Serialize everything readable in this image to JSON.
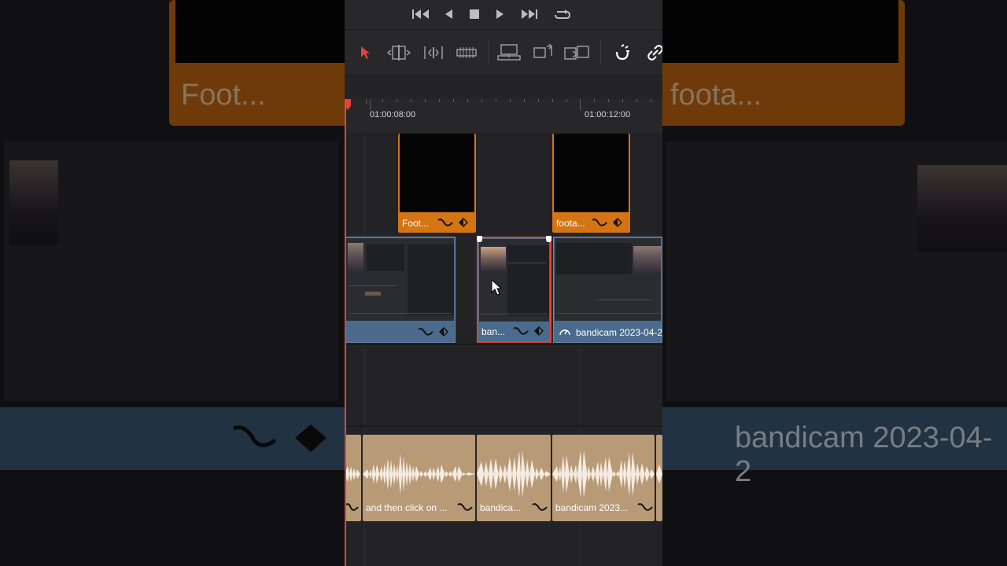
{
  "timeline": {
    "ruler": {
      "tc_left": "01:00:08:00",
      "tc_right": "01:00:12:00"
    },
    "video_track_2": [
      {
        "label": "Foot..."
      },
      {
        "label": "foota..."
      }
    ],
    "video_track_1": [
      {
        "label": ""
      },
      {
        "label": "ban..."
      },
      {
        "label": "bandicam 2023-04-2"
      }
    ],
    "audio_track": [
      {
        "label": ""
      },
      {
        "label": "and then click on ..."
      },
      {
        "label": "bandica..."
      },
      {
        "label": "bandicam 2023..."
      }
    ]
  },
  "background": {
    "left_clip_label": "Foot...",
    "right_clip_label": "foota...",
    "right_strip_label": "bandicam 2023-04-2"
  },
  "colors": {
    "accent_playhead": "#e0443a",
    "video_clip_orange": "#d37415",
    "video_clip_blue": "#4b6b8c",
    "audio_clip": "#b99a77"
  }
}
